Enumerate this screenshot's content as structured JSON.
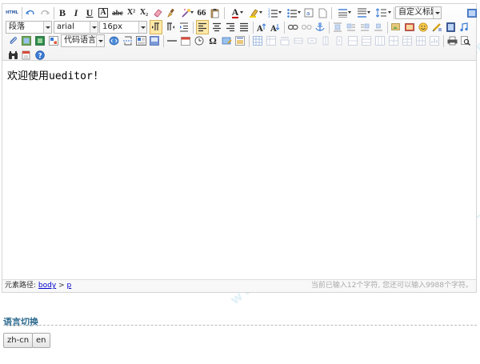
{
  "toolbar": {
    "html_label": "HTML",
    "paragraph_combo": "段落",
    "font_combo": "arial",
    "size_combo": "16px",
    "code_combo": "代码语言",
    "custom_title_combo": "自定义标题",
    "buttons": {
      "bold": "B",
      "italic": "I",
      "underline": "U",
      "fontborder": "A",
      "strikethrough": "abc",
      "superscript": "X²",
      "subscript": "X₂",
      "blockquote": "66",
      "forecolor": "A",
      "omega": "Ω"
    }
  },
  "editor": {
    "content": "欢迎使用ueditor!"
  },
  "statusbar": {
    "path_prefix": "元素路径:",
    "path_body": "body",
    "path_sep": ">",
    "path_p": "p",
    "word_count": "当前已输入12个字符, 您还可以输入9988个字符。"
  },
  "lang": {
    "title": "语言切换",
    "buttons": [
      "zh-cn",
      "en"
    ]
  },
  "watermark": {
    "text_cn": "软件学堂",
    "text_url": "www.xue51.com"
  }
}
